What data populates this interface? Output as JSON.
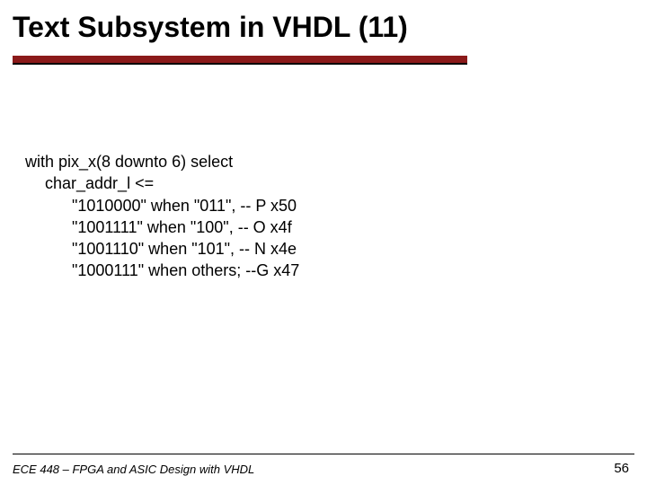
{
  "title": "Text Subsystem in VHDL (11)",
  "code": {
    "l1": "with pix_x(8 downto 6) select",
    "l2": "char_addr_l <=",
    "l3": "\"1010000\" when \"011\", -- P x50",
    "l4": "\"1001111\" when \"100\",  -- O x4f",
    "l5": "\"1001110\" when \"101\",  -- N x4e",
    "l6": "\"1000111\" when others;  --G x47"
  },
  "footer": {
    "left": "ECE 448 – FPGA and ASIC Design with VHDL",
    "page": "56"
  }
}
